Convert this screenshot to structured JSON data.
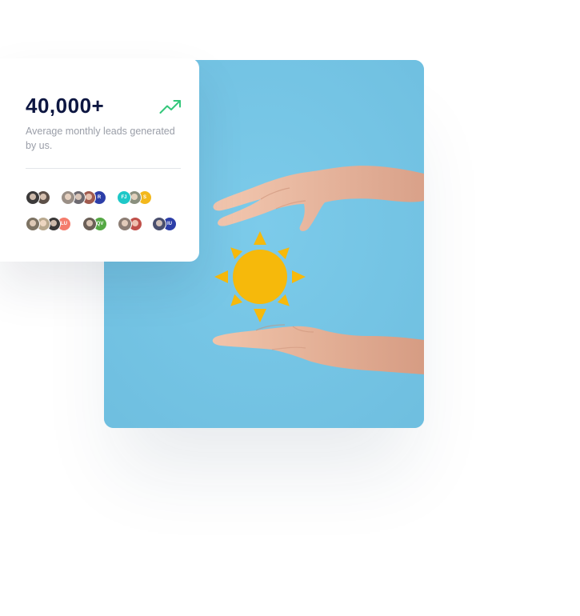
{
  "stat": {
    "value": "40,000+",
    "description": "Average monthly leads generated by us.",
    "trend_icon": "trending-up-icon",
    "trend_color": "#34c77b"
  },
  "colors": {
    "heading": "#0d1641",
    "muted": "#9a9ea8",
    "hero_background": "#77c6e6",
    "sun": "#f6b90b"
  },
  "avatar_groups": [
    [
      {
        "initials": "",
        "color": "#3b3a3a"
      },
      {
        "initials": "",
        "color": "#5c5048"
      }
    ],
    [
      {
        "initials": "",
        "color": "#9a8f86"
      },
      {
        "initials": "",
        "color": "#6d6a70"
      },
      {
        "initials": "",
        "color": "#a05a4e"
      },
      {
        "initials": "R",
        "color": "#2c3ea8"
      }
    ],
    [
      {
        "initials": "FJ",
        "color": "#1ec8c8"
      },
      {
        "initials": "",
        "color": "#8a8f7e"
      },
      {
        "initials": "S",
        "color": "#f3b81c"
      }
    ],
    [
      {
        "initials": "",
        "color": "#7d7363"
      },
      {
        "initials": "",
        "color": "#b8a88e"
      },
      {
        "initials": "",
        "color": "#3a3838"
      },
      {
        "initials": "LU",
        "color": "#f47c6c"
      }
    ],
    [
      {
        "initials": "",
        "color": "#6b5f57"
      },
      {
        "initials": "QV",
        "color": "#55a844"
      }
    ],
    [
      {
        "initials": "",
        "color": "#8c7d74"
      },
      {
        "initials": "",
        "color": "#c0504a"
      }
    ],
    [
      {
        "initials": "",
        "color": "#4a4f6e"
      },
      {
        "initials": "IU",
        "color": "#2c3ea8"
      }
    ]
  ]
}
